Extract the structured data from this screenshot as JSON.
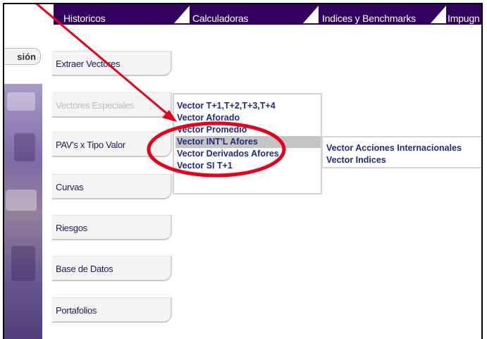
{
  "topbar": {
    "tabs": [
      "Historicos",
      "Calculadoras",
      "Indices y Benchmarks",
      "Impugn"
    ]
  },
  "session_button": "sión",
  "nav": {
    "items": [
      {
        "label": "Extraer Vectores",
        "disabled": false
      },
      {
        "label": "Vectores Especiales",
        "disabled": true
      },
      {
        "label": "PAV's x Tipo Valor",
        "disabled": false
      },
      {
        "label": "Curvas",
        "disabled": false
      },
      {
        "label": "Riesgos",
        "disabled": false
      },
      {
        "label": "Base de Datos",
        "disabled": false
      },
      {
        "label": "Portafolios",
        "disabled": false
      }
    ]
  },
  "submenu": {
    "items": [
      "Vector T+1,T+2,T+3,T+4",
      "Vector Aforado",
      "Vector Promedio",
      "Vector INT'L Afores",
      "Vector Derivados Afores",
      "Vector SI T+1"
    ],
    "selected_index": 3
  },
  "submenu2": {
    "items": [
      "Vector Acciones Internacionales",
      "Vector Indices"
    ]
  },
  "colors": {
    "topbar": "#32005f",
    "menu_text": "#232a7a",
    "annotation": "#e8001a",
    "selected_bg": "#c4c4c4"
  }
}
